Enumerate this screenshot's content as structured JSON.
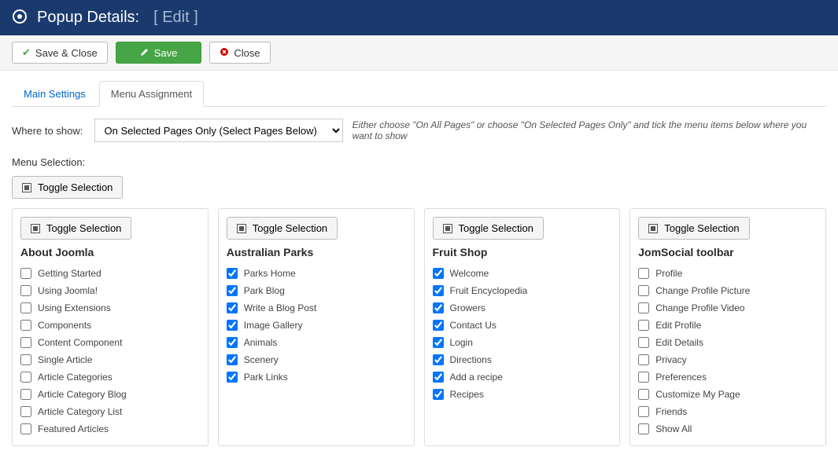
{
  "header": {
    "title": "Popup Details:",
    "edit_label": "[ Edit ]"
  },
  "toolbar": {
    "save_close": "Save & Close",
    "save": "Save",
    "close": "Close"
  },
  "tabs": {
    "main_settings": "Main Settings",
    "menu_assignment": "Menu Assignment"
  },
  "where_to_show": {
    "label": "Where to show:",
    "selected": "On Selected Pages Only (Select Pages Below)",
    "hint": "Either choose \"On All Pages\" or choose \"On Selected Pages Only\" and tick the menu items below where you want to show"
  },
  "menu_selection_label": "Menu Selection:",
  "toggle_selection_label": "Toggle Selection",
  "menus": [
    {
      "title": "About Joomla",
      "items": [
        {
          "label": "Getting Started",
          "checked": false
        },
        {
          "label": "Using Joomla!",
          "checked": false
        },
        {
          "label": "Using Extensions",
          "checked": false
        },
        {
          "label": "Components",
          "checked": false
        },
        {
          "label": "Content Component",
          "checked": false
        },
        {
          "label": "Single Article",
          "checked": false
        },
        {
          "label": "Article Categories",
          "checked": false
        },
        {
          "label": "Article Category Blog",
          "checked": false
        },
        {
          "label": "Article Category List",
          "checked": false
        },
        {
          "label": "Featured Articles",
          "checked": false
        }
      ]
    },
    {
      "title": "Australian Parks",
      "items": [
        {
          "label": "Parks Home",
          "checked": true
        },
        {
          "label": "Park Blog",
          "checked": true
        },
        {
          "label": "Write a Blog Post",
          "checked": true
        },
        {
          "label": "Image Gallery",
          "checked": true
        },
        {
          "label": "Animals",
          "checked": true
        },
        {
          "label": "Scenery",
          "checked": true
        },
        {
          "label": "Park Links",
          "checked": true
        }
      ]
    },
    {
      "title": "Fruit Shop",
      "items": [
        {
          "label": "Welcome",
          "checked": true
        },
        {
          "label": "Fruit Encyclopedia",
          "checked": true
        },
        {
          "label": "Growers",
          "checked": true
        },
        {
          "label": "Contact Us",
          "checked": true
        },
        {
          "label": "Login",
          "checked": true
        },
        {
          "label": "Directions",
          "checked": true
        },
        {
          "label": "Add a recipe",
          "checked": true
        },
        {
          "label": "Recipes",
          "checked": true
        }
      ]
    },
    {
      "title": "JomSocial toolbar",
      "items": [
        {
          "label": "Profile",
          "checked": false
        },
        {
          "label": "Change Profile Picture",
          "checked": false
        },
        {
          "label": "Change Profile Video",
          "checked": false
        },
        {
          "label": "Edit Profile",
          "checked": false
        },
        {
          "label": "Edit Details",
          "checked": false
        },
        {
          "label": "Privacy",
          "checked": false
        },
        {
          "label": "Preferences",
          "checked": false
        },
        {
          "label": "Customize My Page",
          "checked": false
        },
        {
          "label": "Friends",
          "checked": false
        },
        {
          "label": "Show All",
          "checked": false
        }
      ]
    }
  ]
}
